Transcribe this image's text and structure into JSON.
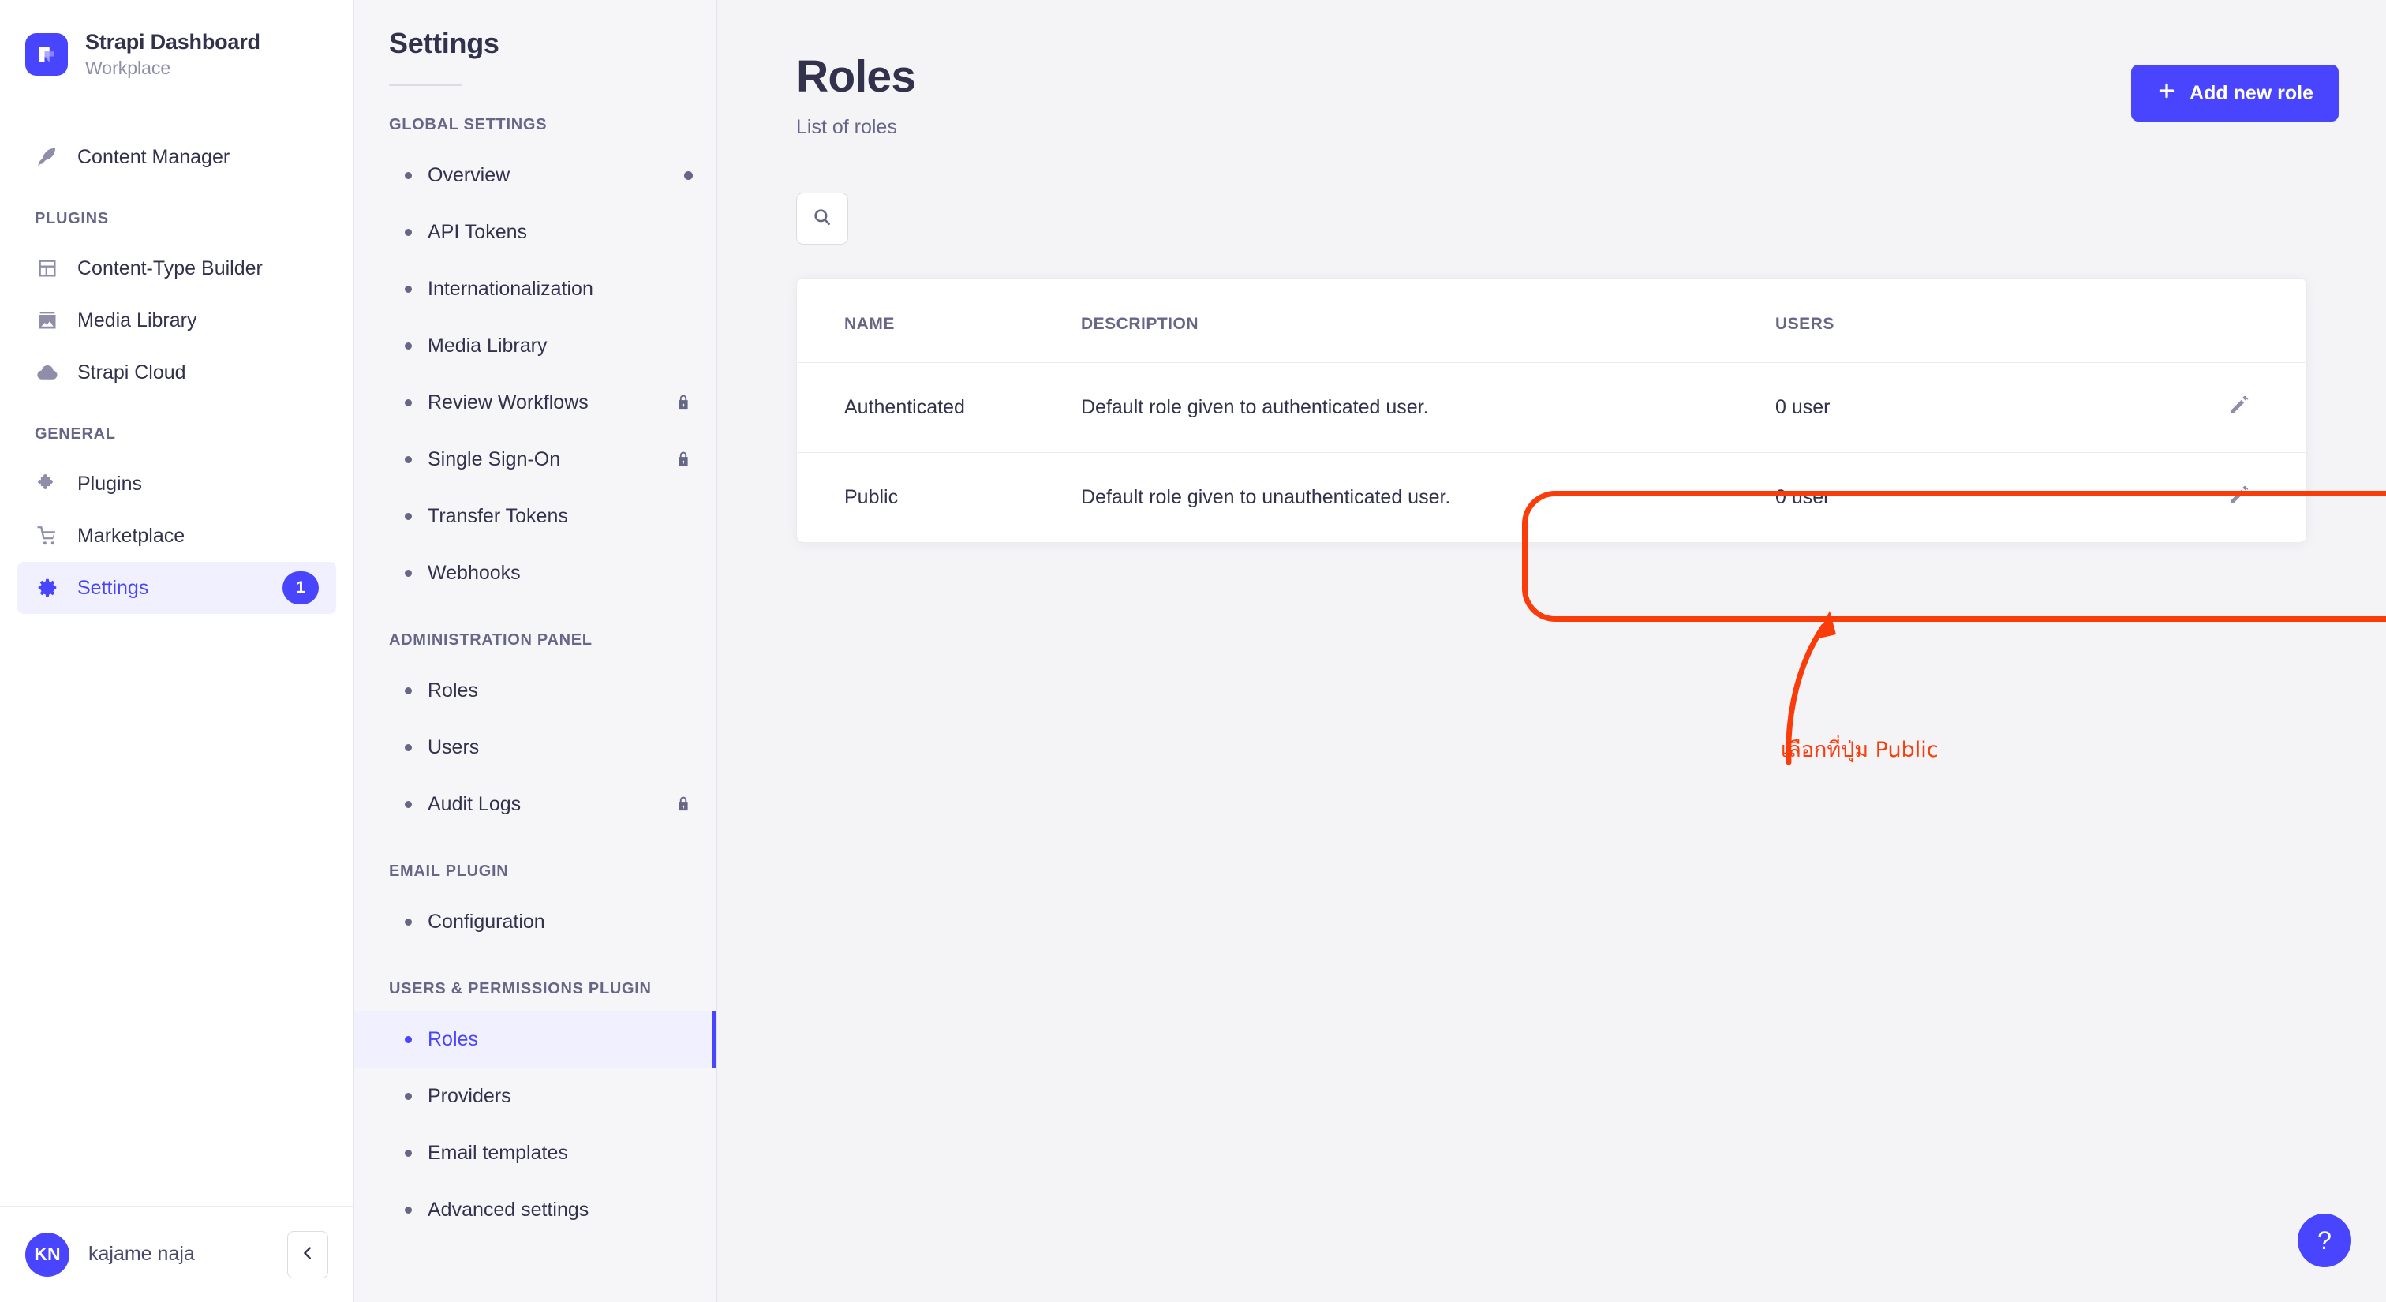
{
  "brand": {
    "title": "Strapi Dashboard",
    "subtitle": "Workplace",
    "logo_icon": "strapi-logo-icon",
    "logo_color": "#4945ff"
  },
  "main_nav": {
    "top_items": [
      {
        "label": "Content Manager",
        "icon": "feather-icon",
        "active": false
      }
    ],
    "groups": [
      {
        "label": "PLUGINS",
        "items": [
          {
            "label": "Content-Type Builder",
            "icon": "layout-icon",
            "active": false
          },
          {
            "label": "Media Library",
            "icon": "image-icon",
            "active": false
          },
          {
            "label": "Strapi Cloud",
            "icon": "cloud-icon",
            "active": false
          }
        ]
      },
      {
        "label": "GENERAL",
        "items": [
          {
            "label": "Plugins",
            "icon": "puzzle-icon",
            "active": false
          },
          {
            "label": "Marketplace",
            "icon": "shopping-cart-icon",
            "active": false
          },
          {
            "label": "Settings",
            "icon": "gear-icon",
            "active": true,
            "badge": "1"
          }
        ]
      }
    ]
  },
  "user": {
    "initials": "KN",
    "name": "kajame naja",
    "collapse_icon": "chevron-left-icon"
  },
  "settings_nav": {
    "title": "Settings",
    "groups": [
      {
        "label": "GLOBAL SETTINGS",
        "items": [
          {
            "label": "Overview",
            "active": false,
            "trailing": "dot"
          },
          {
            "label": "API Tokens",
            "active": false,
            "trailing": ""
          },
          {
            "label": "Internationalization",
            "active": false,
            "trailing": ""
          },
          {
            "label": "Media Library",
            "active": false,
            "trailing": ""
          },
          {
            "label": "Review Workflows",
            "active": false,
            "trailing": "lock"
          },
          {
            "label": "Single Sign-On",
            "active": false,
            "trailing": "lock"
          },
          {
            "label": "Transfer Tokens",
            "active": false,
            "trailing": ""
          },
          {
            "label": "Webhooks",
            "active": false,
            "trailing": ""
          }
        ]
      },
      {
        "label": "ADMINISTRATION PANEL",
        "items": [
          {
            "label": "Roles",
            "active": false,
            "trailing": ""
          },
          {
            "label": "Users",
            "active": false,
            "trailing": ""
          },
          {
            "label": "Audit Logs",
            "active": false,
            "trailing": "lock"
          }
        ]
      },
      {
        "label": "EMAIL PLUGIN",
        "items": [
          {
            "label": "Configuration",
            "active": false,
            "trailing": ""
          }
        ]
      },
      {
        "label": "USERS & PERMISSIONS PLUGIN",
        "items": [
          {
            "label": "Roles",
            "active": true,
            "trailing": ""
          },
          {
            "label": "Providers",
            "active": false,
            "trailing": ""
          },
          {
            "label": "Email templates",
            "active": false,
            "trailing": ""
          },
          {
            "label": "Advanced settings",
            "active": false,
            "trailing": ""
          }
        ]
      }
    ]
  },
  "page": {
    "title": "Roles",
    "subtitle": "List of roles",
    "add_button_label": "Add new role",
    "add_button_icon": "plus-icon",
    "search_icon": "search-icon",
    "help_icon": "question-mark-icon"
  },
  "roles_table": {
    "columns": [
      "NAME",
      "DESCRIPTION",
      "USERS",
      ""
    ],
    "rows": [
      {
        "name": "Authenticated",
        "description": "Default role given to authenticated user.",
        "users": "0 user",
        "edit_icon": "pencil-icon"
      },
      {
        "name": "Public",
        "description": "Default role given to unauthenticated user.",
        "users": "0 user",
        "edit_icon": "pencil-icon"
      }
    ]
  },
  "annotation": {
    "text": "เลือกที่ปุ่ม Public",
    "color": "#fa3b0a",
    "target_row": "Public"
  },
  "colors": {
    "accent": "#4945ff",
    "accent_soft": "#f0f0ff",
    "text_primary": "#32324d",
    "text_muted": "#666687",
    "page_bg": "#f4f4f7",
    "panel_bg": "#f6f6f9",
    "card_bg": "#ffffff",
    "border": "#eaeaef",
    "annotation": "#fa3b0a"
  }
}
